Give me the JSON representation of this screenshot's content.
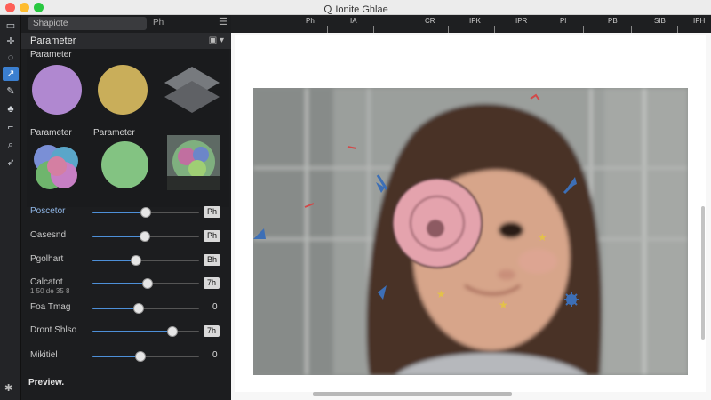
{
  "window": {
    "title": "Ｑ Ionite Ghlae"
  },
  "toolstrip": {
    "tools": [
      {
        "icon": "layers-icon"
      },
      {
        "icon": "transform-icon"
      },
      {
        "icon": "lasso-icon"
      },
      {
        "icon": "arrow-icon",
        "active": true
      },
      {
        "icon": "brush-icon"
      },
      {
        "icon": "stamp-icon"
      },
      {
        "icon": "crop-icon"
      },
      {
        "icon": "chat-icon"
      },
      {
        "icon": "pen-icon"
      }
    ]
  },
  "panel": {
    "search_value": "Shapiote",
    "search_suffix": "Ph",
    "header_title": "Parameter",
    "swatch_top_label": "Parameter",
    "swatch_mid_label_1": "Parameter",
    "swatch_mid_label_2": "Parameter",
    "colors": {
      "purple": "#b088d0",
      "yellow": "#c9ae5a",
      "gray": "#6d6f73",
      "green": "#83c382",
      "accent": "#4d8fd8"
    },
    "params": [
      {
        "label": "Poscetor",
        "value": "Ph",
        "level": 0.5,
        "boxed": true,
        "accent": true
      },
      {
        "label": "Oasesnd",
        "value": "Ph",
        "level": 0.49,
        "boxed": true
      },
      {
        "label": "Pgolhart",
        "value": "Bh",
        "level": 0.41,
        "boxed": true
      },
      {
        "label": "Calcatot",
        "sub": "1 50 de 35 8",
        "value": "7h",
        "level": 0.52,
        "boxed": true
      },
      {
        "label": "Foa Tmag",
        "value": "0",
        "level": 0.43,
        "boxed": false
      },
      {
        "label": "Dront Shlso",
        "value": "7h",
        "level": 0.77,
        "boxed": true
      },
      {
        "label": "Mikitiel",
        "value": "0",
        "level": 0.45,
        "boxed": false
      }
    ],
    "preview_label": "Preview."
  },
  "ruler": {
    "ticks": [
      "Ph",
      "IA",
      "CR",
      "IPK",
      "IPR",
      "Pl",
      "PB",
      "SIB",
      "IPH"
    ]
  }
}
